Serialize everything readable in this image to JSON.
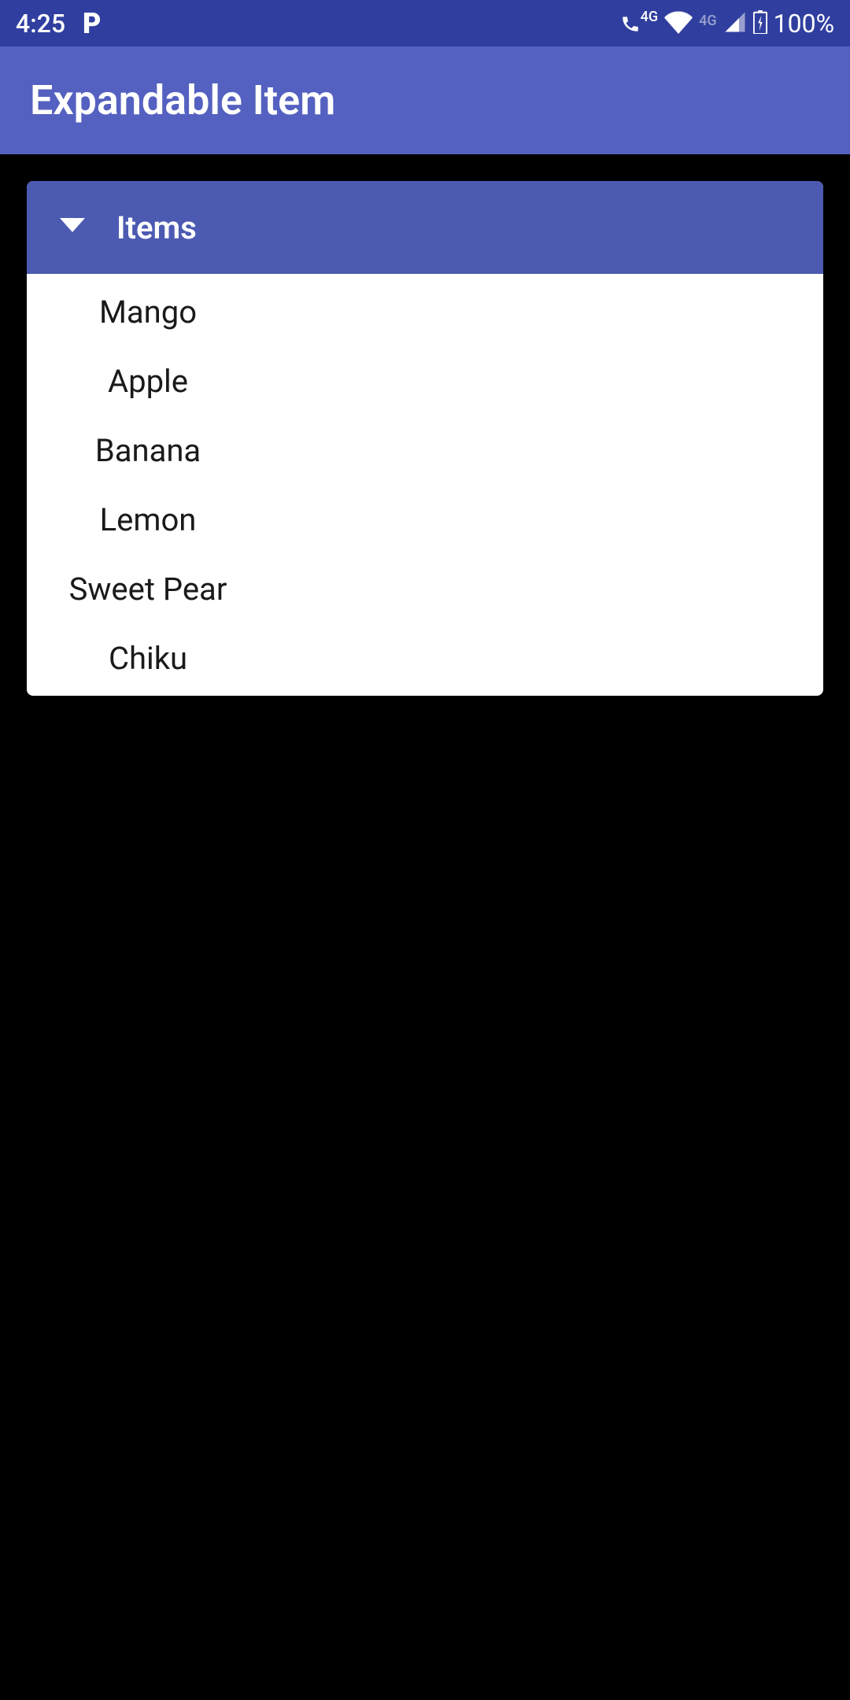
{
  "status_bar": {
    "time": "4:25",
    "net_label_1": "4G",
    "net_label_2": "4G",
    "battery_pct": "100%"
  },
  "app_bar": {
    "title": "Expandable Item"
  },
  "card": {
    "header_label": "Items",
    "items": [
      {
        "label": "Mango"
      },
      {
        "label": "Apple"
      },
      {
        "label": "Banana"
      },
      {
        "label": "Lemon"
      },
      {
        "label": "Sweet Pear"
      },
      {
        "label": "Chiku"
      }
    ]
  }
}
